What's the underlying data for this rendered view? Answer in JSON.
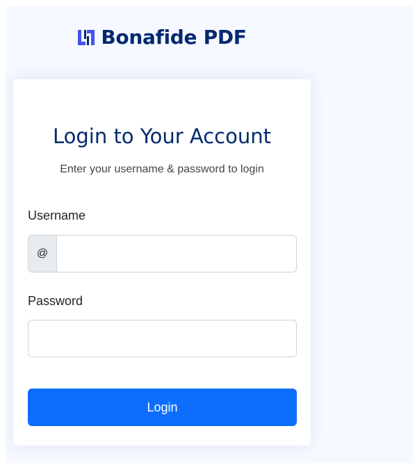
{
  "brand": {
    "logo_icon": "bonafide-logo-icon",
    "name": "Bonafide PDF"
  },
  "login_form": {
    "title": "Login to Your Account",
    "subtitle": "Enter your username & password to login",
    "username": {
      "label": "Username",
      "prefix": "@",
      "value": "",
      "placeholder": ""
    },
    "password": {
      "label": "Password",
      "value": "",
      "placeholder": ""
    },
    "submit_label": "Login"
  },
  "colors": {
    "page_background": "#f6f9ff",
    "brand_text": "#012970",
    "title_text": "#012970",
    "primary_button": "#0d6efd",
    "input_border": "#ced4da",
    "prefix_background": "#e9ecef"
  }
}
